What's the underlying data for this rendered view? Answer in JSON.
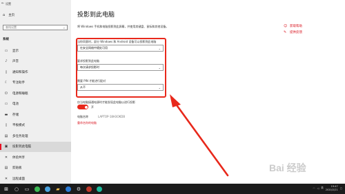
{
  "window": {
    "title": "设置"
  },
  "sidebar": {
    "home_label": "主页",
    "search_placeholder": "查找设置",
    "section_label": "系统",
    "items": [
      {
        "label": "显示",
        "icon": "display-icon"
      },
      {
        "label": "声音",
        "icon": "sound-icon"
      },
      {
        "label": "通知和操作",
        "icon": "notification-icon"
      },
      {
        "label": "专注助手",
        "icon": "focus-assist-icon"
      },
      {
        "label": "电源和睡眠",
        "icon": "power-icon"
      },
      {
        "label": "电池",
        "icon": "battery-icon"
      },
      {
        "label": "存储",
        "icon": "storage-icon"
      },
      {
        "label": "平板模式",
        "icon": "tablet-icon"
      },
      {
        "label": "多任务处理",
        "icon": "multitask-icon"
      },
      {
        "label": "投影到此电脑",
        "icon": "project-icon",
        "active": true
      },
      {
        "label": "体验共享",
        "icon": "shared-experience-icon"
      },
      {
        "label": "剪贴板",
        "icon": "clipboard-icon"
      },
      {
        "label": "远程桌面",
        "icon": "remote-desktop-icon"
      }
    ]
  },
  "main": {
    "title": "投影到此电脑",
    "description": "将 Windows 手机和电脑投影到此屏幕，并使用其键盘、鼠标和其他设备。",
    "field1": {
      "label": "当你同意时，部分 Windows 和 Android 设备可以投影到此电脑",
      "value": "在安全网络中随处可用"
    },
    "field2": {
      "label": "要求投影到此电脑",
      "value": "每次请求投影时"
    },
    "field3": {
      "label": "需要 PIN 才能进行配对",
      "value": "从不"
    },
    "plugged_in_label": "仅当电脑接通电源时才能发现此电脑以进行投影",
    "toggle_state": "开",
    "pc_name_label": "电脑名称",
    "pc_name_value": "LAPTOP-18H3OKDB",
    "rename_link": "重命名你的电脑"
  },
  "help": {
    "get_help": "获取帮助",
    "feedback": "提供反馈"
  },
  "watermark": "Bai 经验",
  "taskbar": {
    "time": "19:47",
    "date": "2020/2/21",
    "lang": "英"
  },
  "colors": {
    "accent": "#e8281b",
    "link": "#d9141f"
  }
}
